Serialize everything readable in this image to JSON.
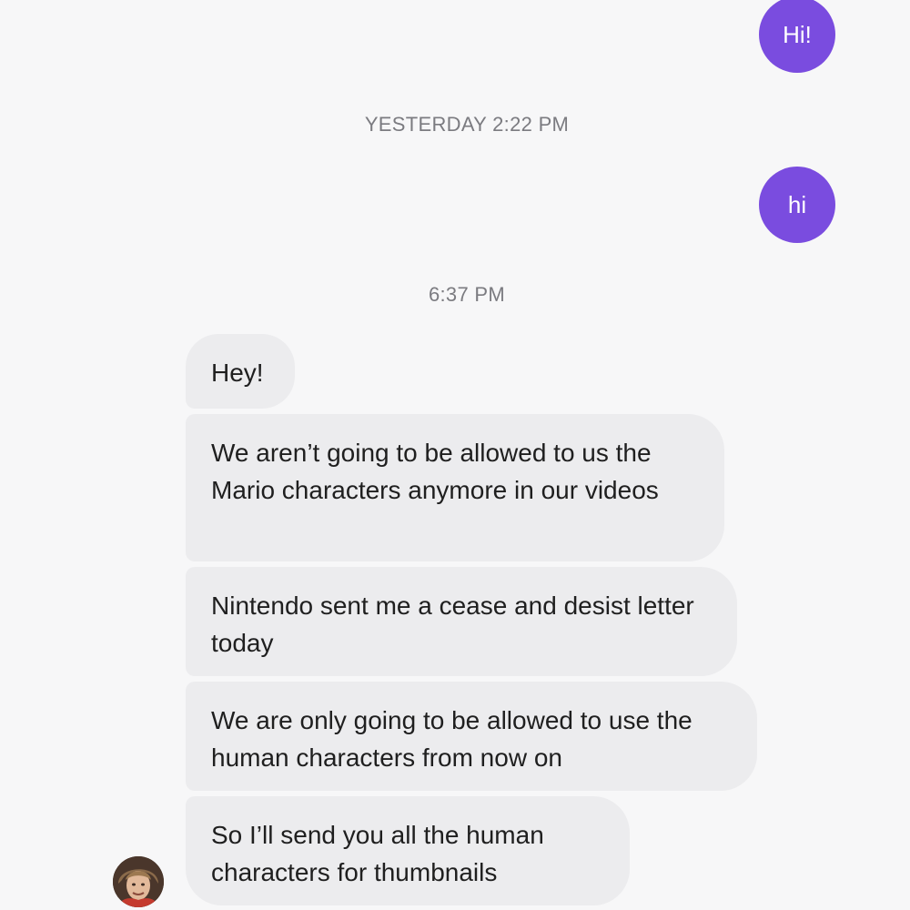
{
  "sent_messages": [
    {
      "text": "Hi!"
    },
    {
      "text": "hi"
    }
  ],
  "timestamps": [
    {
      "text": "YESTERDAY 2:22 PM"
    },
    {
      "text": "6:37 PM"
    }
  ],
  "received_messages": [
    {
      "text": "Hey!"
    },
    {
      "text": "We aren’t going to be allowed to us the Mario characters anymore in our videos"
    },
    {
      "text": "Nintendo sent me a cease and desist letter today"
    },
    {
      "text": "We are only going to be allowed to use the human characters from now on"
    },
    {
      "text": "So I’ll send you all the human characters for thumbnails"
    }
  ],
  "colors": {
    "sent_bubble": "#7a4cdf",
    "received_bubble": "#ececee",
    "background": "#f7f7f8",
    "timestamp_text": "#7b7b80"
  },
  "avatar": {
    "icon": "contact-avatar"
  }
}
